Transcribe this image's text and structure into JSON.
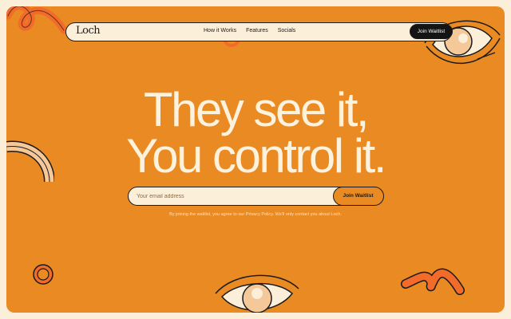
{
  "nav": {
    "logo": "Loch",
    "links": [
      "How it Works",
      "Features",
      "Socials"
    ],
    "cta_label": "Join Waitlist"
  },
  "hero": {
    "headline_line1": "They see it,",
    "headline_line2": "You control it."
  },
  "signup": {
    "email_placeholder": "Your email address",
    "cta_label": "Join Waitlist",
    "disclaimer": "By joining the waitlist, you agree to our Privacy Policy. We'll only contact you about Loch."
  },
  "colors": {
    "background": "#ea8a22",
    "cream": "#fcefd9",
    "ink": "#1b1b1b",
    "accent_shape": "#f26b2b",
    "eye_iris": "#f5c89a"
  }
}
